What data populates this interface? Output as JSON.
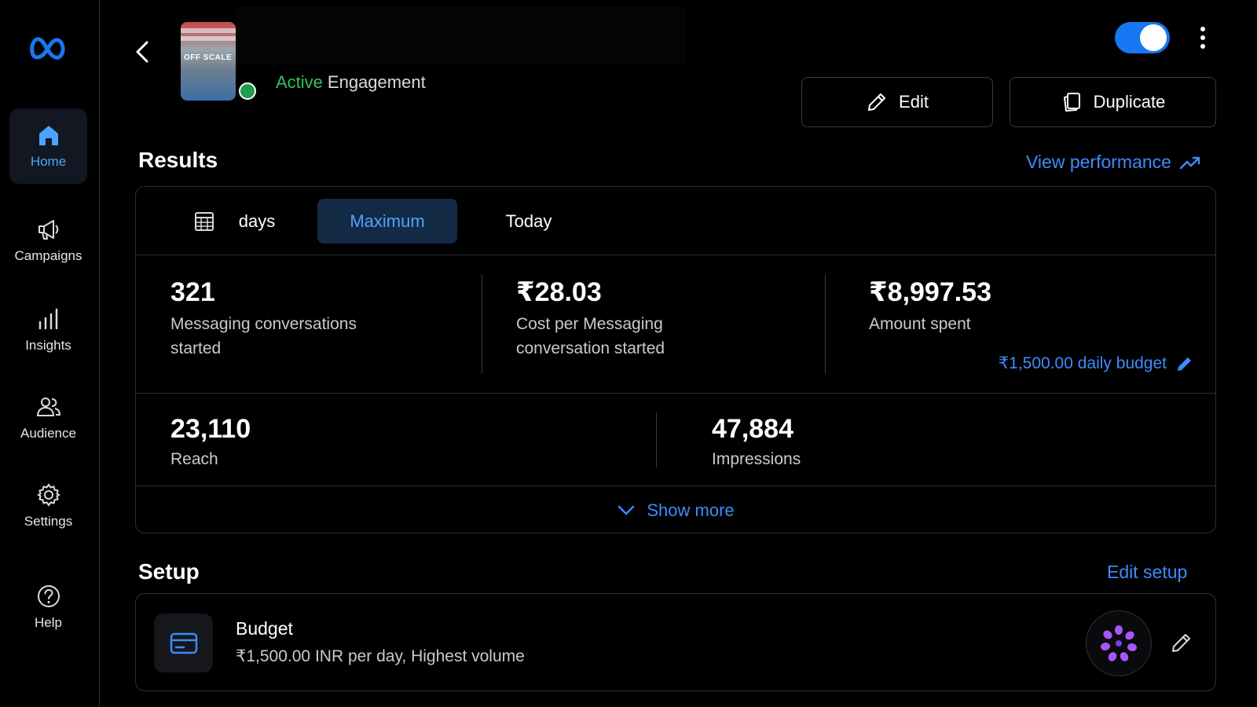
{
  "sidebar": {
    "logo": "meta-logo",
    "items": [
      {
        "label": "Home",
        "icon": "home-icon",
        "active": true
      },
      {
        "label": "Campaigns",
        "icon": "megaphone-icon",
        "active": false
      },
      {
        "label": "Insights",
        "icon": "bar-chart-icon",
        "active": false
      },
      {
        "label": "Audience",
        "icon": "people-icon",
        "active": false
      },
      {
        "label": "Settings",
        "icon": "gear-icon",
        "active": false
      },
      {
        "label": "Help",
        "icon": "help-icon",
        "active": false
      }
    ]
  },
  "header": {
    "thumbnail_text": "OFF SCALE",
    "status": "Active",
    "objective": "Engagement",
    "toggle_on": true,
    "edit_label": "Edit",
    "duplicate_label": "Duplicate"
  },
  "results": {
    "title": "Results",
    "view_performance": "View performance",
    "tabs": [
      {
        "label": "days",
        "selected": false
      },
      {
        "label": "Maximum",
        "selected": true
      },
      {
        "label": "Today",
        "selected": false
      }
    ],
    "metrics": [
      {
        "value": "321",
        "label": "Messaging conversations started"
      },
      {
        "value": "₹28.03",
        "label": "Cost per Messaging conversation started"
      },
      {
        "value": "₹8,997.53",
        "label": "Amount spent"
      },
      {
        "value": "23,110",
        "label": "Reach"
      },
      {
        "value": "47,884",
        "label": "Impressions"
      }
    ],
    "daily_budget": "₹1,500.00 daily budget",
    "show_more": "Show more"
  },
  "setup": {
    "title": "Setup",
    "edit_setup": "Edit setup",
    "budget_title": "Budget",
    "budget_detail": "₹1,500.00 INR per day, Highest volume"
  },
  "colors": {
    "accent": "#3d8bfd",
    "active_status": "#31c25d",
    "toggle": "#1877f2",
    "background": "#000000"
  }
}
